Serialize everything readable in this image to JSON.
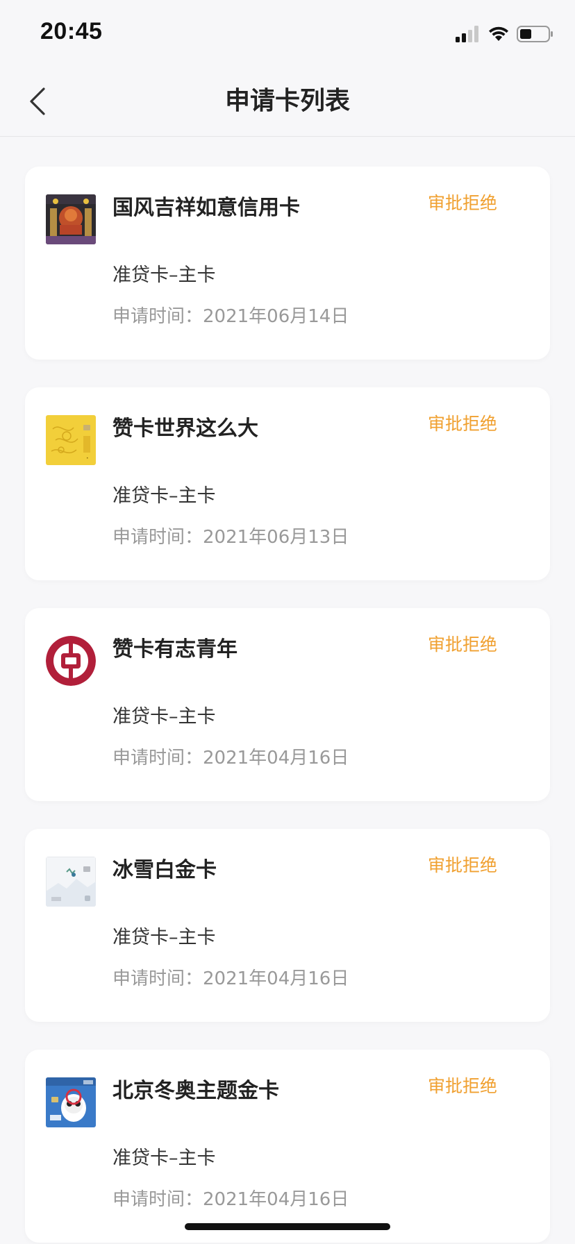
{
  "status_bar": {
    "time": "20:45",
    "icons": [
      "signal-icon",
      "wifi-icon",
      "battery-icon"
    ]
  },
  "nav": {
    "title": "申请卡列表",
    "back_icon": "chevron-left-icon"
  },
  "colors": {
    "status_rejected": "#f0a030",
    "background": "#f7f7f9",
    "card_bg": "#ffffff"
  },
  "date_label": "申请时间：",
  "cards": [
    {
      "name": "国风吉祥如意信用卡",
      "status": "审批拒绝",
      "type": "准贷卡–主卡",
      "date": "2021年06月14日",
      "thumb": "guofeng-card-image"
    },
    {
      "name": "赞卡世界这么大",
      "status": "审批拒绝",
      "type": "准贷卡–主卡",
      "date": "2021年06月13日",
      "thumb": "yellow-card-image"
    },
    {
      "name": "赞卡有志青年",
      "status": "审批拒绝",
      "type": "准贷卡–主卡",
      "date": "2021年04月16日",
      "thumb": "bank-of-china-logo"
    },
    {
      "name": "冰雪白金卡",
      "status": "审批拒绝",
      "type": "准贷卡–主卡",
      "date": "2021年04月16日",
      "thumb": "ice-snow-card-image"
    },
    {
      "name": "北京冬奥主题金卡",
      "status": "审批拒绝",
      "type": "准贷卡–主卡",
      "date": "2021年04月16日",
      "thumb": "winter-olympics-card-image"
    }
  ]
}
